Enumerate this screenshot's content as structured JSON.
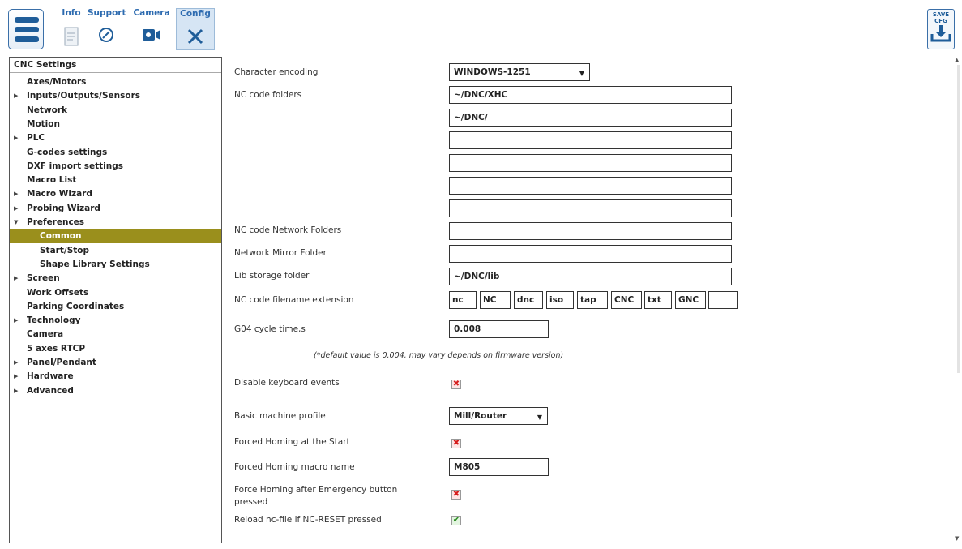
{
  "toolbar": {
    "tabs": [
      {
        "label": "Info",
        "icon": "document-icon"
      },
      {
        "label": "Support",
        "icon": "compass-icon"
      },
      {
        "label": "Camera",
        "icon": "camera-icon"
      },
      {
        "label": "Config",
        "icon": "tools-icon"
      }
    ],
    "save_line1": "SAVE",
    "save_line2": "CFG",
    "accent": "#1f5d99"
  },
  "sidebar": {
    "header": "CNC Settings",
    "items": [
      {
        "label": "Axes/Motors",
        "expandable": false
      },
      {
        "label": "Inputs/Outputs/Sensors",
        "expandable": true
      },
      {
        "label": "Network",
        "expandable": false
      },
      {
        "label": "Motion",
        "expandable": false
      },
      {
        "label": "PLC",
        "expandable": true
      },
      {
        "label": "G-codes settings",
        "expandable": false
      },
      {
        "label": "DXF import settings",
        "expandable": false
      },
      {
        "label": "Macro List",
        "expandable": false
      },
      {
        "label": "Macro Wizard",
        "expandable": true
      },
      {
        "label": "Probing Wizard",
        "expandable": true
      },
      {
        "label": "Preferences",
        "expandable": true,
        "expanded": true
      },
      {
        "label": "Common",
        "child": true,
        "selected": true
      },
      {
        "label": "Start/Stop",
        "child": true
      },
      {
        "label": "Shape Library Settings",
        "child": true
      },
      {
        "label": "Screen",
        "expandable": true
      },
      {
        "label": "Work Offsets",
        "expandable": false
      },
      {
        "label": "Parking Coordinates",
        "expandable": false
      },
      {
        "label": "Technology",
        "expandable": true
      },
      {
        "label": "Camera",
        "expandable": false
      },
      {
        "label": "5 axes RTCP",
        "expandable": false
      },
      {
        "label": "Panel/Pendant",
        "expandable": true
      },
      {
        "label": "Hardware",
        "expandable": true
      },
      {
        "label": "Advanced",
        "expandable": true
      }
    ],
    "selected_color": "#9a8f1c"
  },
  "settings": {
    "char_encoding_label": "Character encoding",
    "char_encoding_value": "WINDOWS-1251",
    "nc_folders_label": "NC code folders",
    "nc_folders": [
      "~/DNC/XHC",
      "~/DNC/",
      "",
      "",
      "",
      ""
    ],
    "nc_net_folders_label": "NC code Network Folders",
    "nc_net_folders_value": "",
    "net_mirror_label": "Network Mirror Folder",
    "net_mirror_value": "",
    "lib_storage_label": "Lib storage folder",
    "lib_storage_value": "~/DNC/lib",
    "ext_label": "NC code filename extension",
    "extensions": [
      "nc",
      "NC",
      "dnc",
      "iso",
      "tap",
      "CNC",
      "txt",
      "GNC",
      ""
    ],
    "g04_label": "G04 cycle time,s",
    "g04_value": "0.008",
    "g04_note": "(*default value is 0.004, may vary depends on firmware version)",
    "disable_kbd_label": "Disable keyboard events",
    "disable_kbd_checked": false,
    "machine_profile_label": "Basic machine profile",
    "machine_profile_value": "Mill/Router",
    "forced_homing_label": "Forced Homing at the Start",
    "forced_homing_checked": false,
    "homing_macro_label": "Forced Homing macro name",
    "homing_macro_value": "M805",
    "homing_emerg_label_1": "Force Homing after Emergency button",
    "homing_emerg_label_2": "pressed",
    "homing_emerg_checked": false,
    "reload_label": "Reload nc-file if NC-RESET pressed",
    "reload_checked": true,
    "unchecked_mark": "✖",
    "checked_mark": "✔"
  }
}
